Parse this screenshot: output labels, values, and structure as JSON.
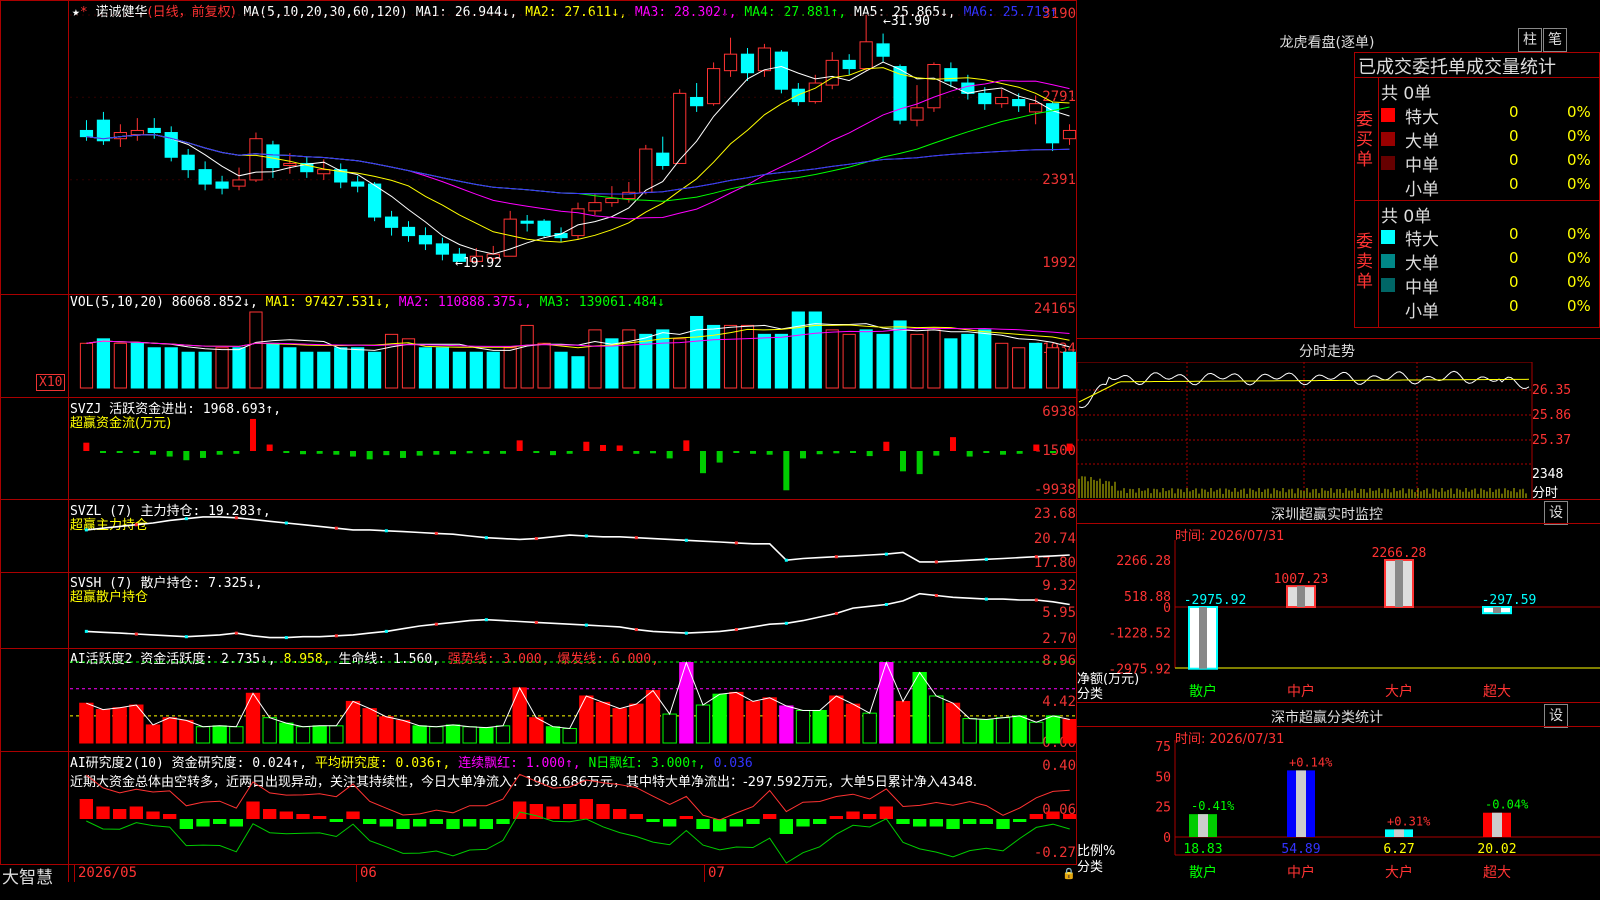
{
  "main_chart": {
    "stock_name": "诺诚健华",
    "period_mode": "(日线，前复权)",
    "ma_def": "MA(5,10,20,30,60,120)",
    "ma1": "MA1: 26.944↓,",
    "ma2": "MA2: 27.611↓,",
    "ma3": "MA3: 28.302↓,",
    "ma4": "MA4: 27.881↑,",
    "ma5": "MA5: 25.865↓,",
    "ma6": "MA6: 25.719↑",
    "y_labels": [
      "3190",
      "2791",
      "2391",
      "1992"
    ],
    "high_label": "31.90",
    "low_label": "←19.92",
    "candles": [
      {
        "o": 26.3,
        "c": 26.0,
        "h": 26.8,
        "l": 25.8
      },
      {
        "o": 26.8,
        "c": 25.8,
        "h": 27.2,
        "l": 25.6
      },
      {
        "o": 25.9,
        "c": 26.2,
        "h": 26.6,
        "l": 25.5
      },
      {
        "o": 26.1,
        "c": 26.3,
        "h": 26.9,
        "l": 25.8
      },
      {
        "o": 26.4,
        "c": 26.2,
        "h": 26.9,
        "l": 25.9
      },
      {
        "o": 26.2,
        "c": 25.0,
        "h": 26.5,
        "l": 24.8
      },
      {
        "o": 25.1,
        "c": 24.4,
        "h": 25.4,
        "l": 24.0
      },
      {
        "o": 24.4,
        "c": 23.7,
        "h": 24.8,
        "l": 23.4
      },
      {
        "o": 23.8,
        "c": 23.5,
        "h": 24.1,
        "l": 23.2
      },
      {
        "o": 23.6,
        "c": 23.9,
        "h": 24.5,
        "l": 23.4
      },
      {
        "o": 23.9,
        "c": 25.9,
        "h": 26.2,
        "l": 23.8
      },
      {
        "o": 25.6,
        "c": 24.5,
        "h": 25.8,
        "l": 24.0
      },
      {
        "o": 24.6,
        "c": 24.7,
        "h": 25.2,
        "l": 24.2
      },
      {
        "o": 24.7,
        "c": 24.3,
        "h": 25.0,
        "l": 24.0
      },
      {
        "o": 24.2,
        "c": 24.4,
        "h": 24.9,
        "l": 23.9
      },
      {
        "o": 24.4,
        "c": 23.8,
        "h": 24.7,
        "l": 23.5
      },
      {
        "o": 23.8,
        "c": 23.6,
        "h": 24.1,
        "l": 23.3
      },
      {
        "o": 23.7,
        "c": 22.1,
        "h": 23.8,
        "l": 21.9
      },
      {
        "o": 22.1,
        "c": 21.6,
        "h": 22.4,
        "l": 21.2
      },
      {
        "o": 21.6,
        "c": 21.2,
        "h": 21.9,
        "l": 20.9
      },
      {
        "o": 21.2,
        "c": 20.8,
        "h": 21.6,
        "l": 20.5
      },
      {
        "o": 20.8,
        "c": 20.3,
        "h": 21.1,
        "l": 20.0
      },
      {
        "o": 20.3,
        "c": 19.95,
        "h": 20.6,
        "l": 19.92
      },
      {
        "o": 19.95,
        "c": 20.2,
        "h": 20.6,
        "l": 19.92
      },
      {
        "o": 20.1,
        "c": 20.3,
        "h": 20.7,
        "l": 19.95
      },
      {
        "o": 20.2,
        "c": 22.0,
        "h": 22.4,
        "l": 20.2
      },
      {
        "o": 21.9,
        "c": 21.8,
        "h": 22.2,
        "l": 21.4
      },
      {
        "o": 21.9,
        "c": 21.2,
        "h": 22.0,
        "l": 21.1
      },
      {
        "o": 21.3,
        "c": 21.1,
        "h": 21.6,
        "l": 20.9
      },
      {
        "o": 21.2,
        "c": 22.5,
        "h": 22.8,
        "l": 21.0
      },
      {
        "o": 22.4,
        "c": 22.8,
        "h": 23.2,
        "l": 22.2
      },
      {
        "o": 22.8,
        "c": 23.0,
        "h": 23.6,
        "l": 22.6
      },
      {
        "o": 23.0,
        "c": 23.3,
        "h": 23.8,
        "l": 22.8
      },
      {
        "o": 23.3,
        "c": 25.4,
        "h": 25.6,
        "l": 23.2
      },
      {
        "o": 25.2,
        "c": 24.6,
        "h": 26.0,
        "l": 24.4
      },
      {
        "o": 24.7,
        "c": 28.1,
        "h": 28.3,
        "l": 24.7
      },
      {
        "o": 27.9,
        "c": 27.5,
        "h": 28.6,
        "l": 27.2
      },
      {
        "o": 27.6,
        "c": 29.3,
        "h": 29.6,
        "l": 27.5
      },
      {
        "o": 29.2,
        "c": 30.0,
        "h": 30.8,
        "l": 28.9
      },
      {
        "o": 30.0,
        "c": 29.1,
        "h": 30.3,
        "l": 28.7
      },
      {
        "o": 29.2,
        "c": 30.3,
        "h": 30.5,
        "l": 28.9
      },
      {
        "o": 30.1,
        "c": 28.3,
        "h": 30.2,
        "l": 28.1
      },
      {
        "o": 28.3,
        "c": 27.7,
        "h": 28.6,
        "l": 27.5
      },
      {
        "o": 27.7,
        "c": 28.6,
        "h": 29.0,
        "l": 27.6
      },
      {
        "o": 28.5,
        "c": 29.7,
        "h": 30.1,
        "l": 28.3
      },
      {
        "o": 29.7,
        "c": 29.3,
        "h": 30.0,
        "l": 29.0
      },
      {
        "o": 29.3,
        "c": 30.6,
        "h": 31.9,
        "l": 29.2
      },
      {
        "o": 30.5,
        "c": 29.9,
        "h": 31.0,
        "l": 29.6
      },
      {
        "o": 29.4,
        "c": 26.8,
        "h": 29.5,
        "l": 26.6
      },
      {
        "o": 26.8,
        "c": 27.4,
        "h": 28.5,
        "l": 26.5
      },
      {
        "o": 27.4,
        "c": 29.5,
        "h": 29.6,
        "l": 27.2
      },
      {
        "o": 29.3,
        "c": 28.7,
        "h": 29.6,
        "l": 28.4
      },
      {
        "o": 28.6,
        "c": 28.1,
        "h": 29.0,
        "l": 27.8
      },
      {
        "o": 28.1,
        "c": 27.6,
        "h": 28.4,
        "l": 27.3
      },
      {
        "o": 27.6,
        "c": 27.9,
        "h": 28.3,
        "l": 27.4
      },
      {
        "o": 27.8,
        "c": 27.5,
        "h": 28.1,
        "l": 27.2
      },
      {
        "o": 27.2,
        "c": 27.6,
        "h": 28.0,
        "l": 26.6
      },
      {
        "o": 27.6,
        "c": 25.7,
        "h": 27.7,
        "l": 25.3
      },
      {
        "o": 25.9,
        "c": 26.3,
        "h": 26.6,
        "l": 25.6
      }
    ]
  },
  "vol_panel": {
    "title": "VOL(5,10,20)",
    "val": "86068.852↓,",
    "ma1": "MA1: 97427.531↓,",
    "ma2": "MA2: 110888.375↓,",
    "ma3": "MA3: 139061.484↓",
    "y_labels": [
      "24165",
      "11934"
    ],
    "unit": "X10",
    "bars": [
      10,
      11,
      10,
      10,
      9,
      9,
      8,
      8,
      9,
      9,
      17,
      10,
      9,
      8,
      8,
      9,
      9,
      8,
      12,
      11,
      9,
      9,
      8,
      8,
      8,
      9,
      14,
      10,
      8,
      7,
      13,
      11,
      13,
      12,
      13,
      11,
      16,
      14,
      14,
      14,
      12,
      12,
      17,
      17,
      13,
      12,
      13,
      12,
      15,
      12,
      13,
      11,
      12,
      13,
      10,
      9,
      10,
      9,
      8
    ],
    "vol_colors": [
      "r",
      "c",
      "r",
      "c",
      "c",
      "c",
      "c",
      "c",
      "r",
      "c",
      "r",
      "c",
      "c",
      "c",
      "c",
      "c",
      "c",
      "c",
      "r",
      "r",
      "c",
      "c",
      "c",
      "c",
      "c",
      "r",
      "r",
      "r",
      "c",
      "c",
      "r",
      "c",
      "r",
      "c",
      "c",
      "r",
      "c",
      "c",
      "r",
      "r",
      "c",
      "c",
      "c",
      "c",
      "r",
      "r",
      "c",
      "c",
      "c",
      "r",
      "r",
      "c",
      "c",
      "c",
      "r",
      "r",
      "c",
      "r",
      "c"
    ]
  },
  "svzj_panel": {
    "title": "SVZJ  活跃资金进出: 1968.693↑,",
    "subtitle": "超赢资金流(万元)",
    "y_labels": [
      "6938",
      "-1500",
      "-9938"
    ],
    "values": [
      1800,
      -300,
      -200,
      -300,
      -800,
      -1200,
      -2000,
      -1500,
      -800,
      -600,
      6938,
      1400,
      -300,
      -700,
      -600,
      -800,
      -1200,
      -1800,
      -900,
      -1500,
      -1000,
      -800,
      -700,
      -500,
      -600,
      -600,
      2300,
      -300,
      -900,
      -600,
      2000,
      1300,
      1200,
      -600,
      -500,
      -1600,
      2300,
      -4800,
      -2500,
      -400,
      -600,
      -800,
      -8500,
      -1600,
      -700,
      -500,
      -400,
      -1100,
      2000,
      -4400,
      -5000,
      -1000,
      3000,
      -1200,
      -400,
      -800,
      -600,
      1400,
      -300,
      1600
    ]
  },
  "svzl_panel": {
    "title": "SVZL (7) 主力持仓: 19.283↑,",
    "subtitle": "超赢主力持仓",
    "y_labels": [
      "23.68",
      "20.74",
      "17.80"
    ],
    "values": [
      22.2,
      22.4,
      22.6,
      22.8,
      23.0,
      23.3,
      23.5,
      23.7,
      23.7,
      23.6,
      23.4,
      23.2,
      23.0,
      22.8,
      22.6,
      22.4,
      22.2,
      22.2,
      22.1,
      22.0,
      21.9,
      21.8,
      21.7,
      21.5,
      21.3,
      21.2,
      21.1,
      21.2,
      21.4,
      21.6,
      21.5,
      21.4,
      21.4,
      21.3,
      21.2,
      21.1,
      21.0,
      20.9,
      20.8,
      20.7,
      20.6,
      20.6,
      18.7,
      18.9,
      19.0,
      19.1,
      19.2,
      19.3,
      19.4,
      19.6,
      18.5,
      18.5,
      18.6,
      18.7,
      18.8,
      18.9,
      19.0,
      19.1,
      19.2,
      19.3
    ]
  },
  "svsh_panel": {
    "title": "SVSH (7) 散户持仓: 7.325↓,",
    "subtitle": "超赢散户持仓",
    "y_labels": [
      "9.32",
      "5.95",
      "2.70"
    ],
    "values": [
      4.0,
      3.9,
      3.8,
      3.7,
      3.6,
      3.5,
      3.4,
      3.5,
      3.6,
      3.8,
      3.5,
      3.3,
      3.3,
      3.4,
      3.4,
      3.5,
      3.6,
      3.8,
      4.0,
      4.3,
      4.6,
      4.8,
      5.0,
      5.2,
      5.3,
      5.2,
      5.1,
      5.0,
      4.9,
      4.8,
      4.7,
      4.6,
      4.5,
      4.2,
      4.0,
      3.9,
      3.8,
      3.9,
      4.0,
      4.2,
      4.5,
      4.8,
      4.9,
      5.2,
      5.6,
      6.0,
      6.6,
      6.8,
      7.0,
      7.4,
      8.2,
      8.0,
      7.8,
      7.7,
      7.6,
      7.6,
      7.5,
      7.5,
      7.3,
      7.0
    ]
  },
  "ai_active": {
    "title": "AI活跃度2 资金活跃度: 2.735↓,",
    "v2": "8.958,",
    "life": "生命线: 1.560,",
    "strong": "强势线: 3.000,",
    "burst": "爆发线: 6.000,",
    "y_labels": [
      "8.96",
      "4.42",
      "0.00"
    ],
    "values": [
      4.4,
      3.7,
      3.9,
      4.2,
      2.0,
      2.8,
      2.5,
      1.8,
      1.9,
      1.8,
      5.5,
      2.8,
      2.2,
      1.8,
      1.9,
      1.9,
      4.6,
      3.8,
      2.9,
      2.5,
      1.9,
      1.8,
      2.0,
      1.8,
      1.7,
      1.9,
      6.1,
      2.8,
      1.8,
      1.6,
      5.2,
      4.5,
      3.8,
      4.3,
      5.8,
      3.2,
      8.9,
      4.2,
      5.4,
      5.6,
      4.6,
      5.0,
      4.1,
      3.6,
      3.6,
      5.2,
      4.3,
      3.3,
      8.9,
      4.6,
      7.8,
      5.2,
      4.4,
      2.7,
      2.6,
      2.8,
      3.0,
      2.3,
      3.0,
      2.6
    ],
    "colors": [
      "r",
      "r",
      "r",
      "r",
      "r",
      "r",
      "r",
      "g",
      "g",
      "g",
      "r",
      "g",
      "g",
      "g",
      "g",
      "g",
      "r",
      "r",
      "r",
      "r",
      "g",
      "g",
      "g",
      "g",
      "g",
      "g",
      "r",
      "r",
      "g",
      "g",
      "r",
      "r",
      "r",
      "r",
      "r",
      "g",
      "m",
      "g",
      "g",
      "r",
      "r",
      "r",
      "m",
      "g",
      "g",
      "r",
      "r",
      "g",
      "m",
      "r",
      "g",
      "g",
      "r",
      "g",
      "g",
      "g",
      "g",
      "g",
      "g",
      "r"
    ]
  },
  "ai_research": {
    "title": "AI研究度2(10) 资金研究度: 0.024↑,",
    "avg": "平均研究度: 0.036↑,",
    "lianxu": "连续飘红: 1.000↑,",
    "nday": "N日飘红: 3.000↑,",
    "v5": "0.036",
    "comment": "近期大资金总体由空转多，近两日出现异动，关注其持续性，今日大单净流入：1968.686万元，其中特大单净流出：-297.592万元，大单5日累计净入4348.",
    "y_labels": [
      "0.40",
      "0.06",
      "-0.27"
    ],
    "values": [
      0.08,
      0.05,
      0.04,
      0.05,
      0.03,
      0.02,
      -0.04,
      -0.03,
      -0.02,
      -0.03,
      0.07,
      0.04,
      0.03,
      0.02,
      0.01,
      -0.01,
      0.03,
      -0.02,
      -0.03,
      -0.04,
      -0.03,
      -0.02,
      -0.04,
      -0.03,
      -0.04,
      -0.02,
      0.07,
      0.06,
      0.05,
      0.06,
      0.08,
      0.06,
      0.04,
      0.02,
      -0.01,
      -0.03,
      0.01,
      -0.04,
      -0.05,
      -0.03,
      -0.02,
      0.02,
      -0.06,
      -0.03,
      -0.02,
      0.01,
      0.03,
      0.02,
      0.05,
      -0.02,
      -0.03,
      -0.03,
      -0.04,
      -0.02,
      -0.02,
      -0.04,
      -0.01,
      0.02,
      0.03,
      0.02
    ]
  },
  "x_axis": {
    "labels": [
      "2026/05",
      "06",
      "07"
    ]
  },
  "brand": "大智慧",
  "right": {
    "lhb_title": "龙虎看盘(逐单)",
    "btn_zhu": "柱",
    "btn_bi": "笔",
    "order_stats_title": "已成交委托单成交量统计",
    "buy": {
      "label": "委买单",
      "total": "共 0单",
      "rows": [
        {
          "name": "特大",
          "count": "0",
          "pct": "0%",
          "color": "#f00"
        },
        {
          "name": "大单",
          "count": "0",
          "pct": "0%",
          "color": "#900"
        },
        {
          "name": "中单",
          "count": "0",
          "pct": "0%",
          "color": "#600"
        },
        {
          "name": "小单",
          "count": "0",
          "pct": "0%",
          "color": "#000"
        }
      ]
    },
    "sell": {
      "label": "委卖单",
      "total": "共 0单",
      "rows": [
        {
          "name": "特大",
          "count": "0",
          "pct": "0%",
          "color": "#0ff"
        },
        {
          "name": "大单",
          "count": "0",
          "pct": "0%",
          "color": "#088"
        },
        {
          "name": "中单",
          "count": "0",
          "pct": "0%",
          "color": "#066"
        },
        {
          "name": "小单",
          "count": "0",
          "pct": "0%",
          "color": "#000"
        }
      ]
    },
    "intraday_title": "分时走势",
    "intraday_y": [
      "26.35",
      "25.86",
      "25.37"
    ],
    "intraday_vol": [
      "2348",
      "分时"
    ],
    "sz_monitor_title": "深圳超赢实时监控",
    "sz_monitor_btn": "设",
    "sz_monitor_time": "时间: 2026/07/31",
    "sz_y": [
      "2266.28",
      "518.88",
      "0",
      "-1228.52",
      "-2975.92"
    ],
    "sz_net_label": "净额(万元)",
    "sz_class_label": "分类",
    "sz_categories": [
      "散户",
      "中户",
      "大户",
      "超大"
    ],
    "sz_values": [
      -2975.92,
      1007.23,
      2266.28,
      -297.59
    ],
    "sz_value_labels": [
      "-2975.92",
      "1007.23",
      "2266.28",
      "-297.59"
    ],
    "class_stats_title": "深市超赢分类统计",
    "class_stats_btn": "设",
    "class_stats_time": "时间: 2026/07/31",
    "cs_y": [
      "75",
      "50",
      "25",
      "0"
    ],
    "cs_ratio_label": "比例%",
    "cs_class_label": "分类",
    "cs_categories": [
      "散户",
      "中户",
      "大户",
      "超大"
    ],
    "cs_values": [
      18.83,
      54.89,
      6.27,
      20.02
    ],
    "cs_value_labels": [
      "18.83",
      "54.89",
      "6.27",
      "20.02"
    ],
    "cs_change": [
      "-0.41%",
      "+0.14%",
      "+0.31%",
      "-0.04%"
    ]
  }
}
